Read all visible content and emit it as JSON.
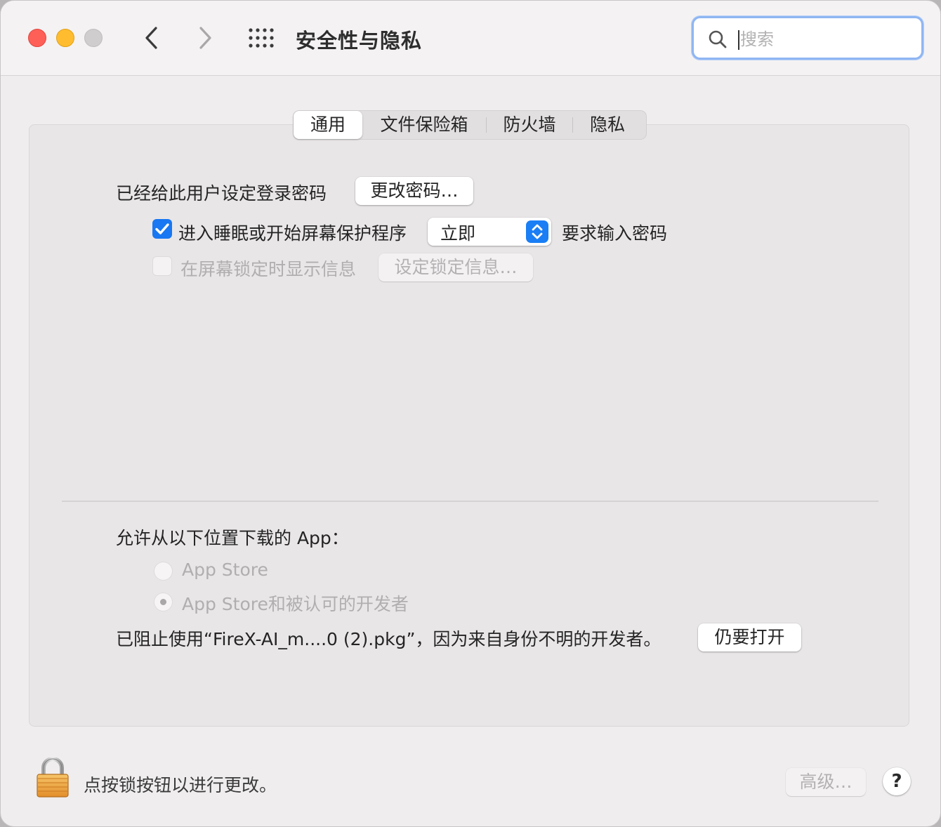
{
  "window": {
    "title": "安全性与隐私"
  },
  "search": {
    "placeholder": "搜索"
  },
  "tabs": [
    {
      "label": "通用",
      "active": true
    },
    {
      "label": "文件保险箱",
      "active": false
    },
    {
      "label": "防火墙",
      "active": false
    },
    {
      "label": "隐私",
      "active": false
    }
  ],
  "general": {
    "password_label": "已经给此用户设定登录密码",
    "change_password_button": "更改密码…",
    "require_password": {
      "checked": true,
      "label": "进入睡眠或开始屏幕保护程序",
      "delay_value": "立即",
      "suffix": "要求输入密码"
    },
    "lock_message": {
      "checked": false,
      "enabled": false,
      "label": "在屏幕锁定时显示信息",
      "button": "设定锁定信息…"
    }
  },
  "downloads": {
    "heading": "允许从以下位置下载的 App：",
    "options": [
      {
        "label": "App Store",
        "selected": false
      },
      {
        "label": "App Store和被认可的开发者",
        "selected": true
      }
    ],
    "blocked_message": "已阻止使用“FireX-AI_m....0 (2).pkg”，因为来自身份不明的开发者。",
    "open_anyway_button": "仍要打开"
  },
  "footer": {
    "lock_text": "点按锁按钮以进行更改。",
    "advanced_button": "高级…",
    "help_button": "?"
  },
  "colors": {
    "accent": "#1877f2",
    "close": "#fe5f57",
    "minimize": "#febc2e",
    "zoom_disabled": "#cfcdce"
  },
  "icons": {
    "back": "chevron-left-icon",
    "forward": "chevron-right-icon",
    "show_all": "grid-icon",
    "search": "search-icon",
    "lock": "lock-icon"
  }
}
